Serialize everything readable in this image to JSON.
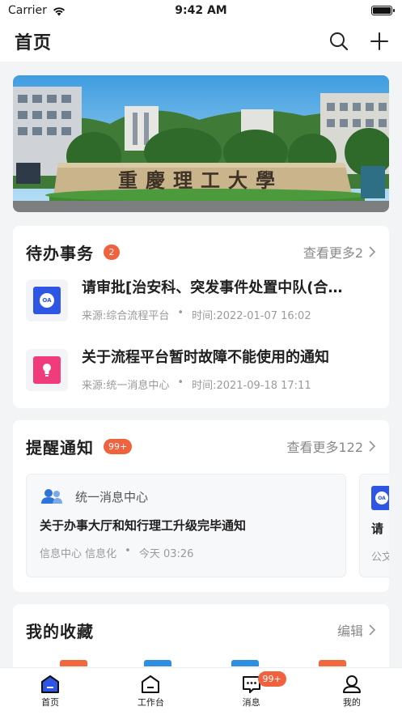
{
  "status_bar": {
    "carrier": "Carrier",
    "time": "9:42 AM"
  },
  "header": {
    "title": "首页"
  },
  "banner": {
    "gate_text": "重慶理工大學"
  },
  "todo": {
    "title": "待办事务",
    "badge": "2",
    "more": "查看更多2",
    "items": [
      {
        "icon": "OA",
        "icon_color": "#2f55e4",
        "title": "请审批[治安科、突发事件处置中队(合…",
        "source": "来源:综合流程平台",
        "time": "时间:2022-01-07 16:02"
      },
      {
        "icon": "lightbulb",
        "icon_color": "#f03c7b",
        "title": "关于流程平台暂时故障不能使用的通知",
        "source": "来源:统一消息中心",
        "time": "时间:2021-09-18 17:11"
      }
    ]
  },
  "reminders": {
    "title": "提醒通知",
    "badge": "99+",
    "more": "查看更多122",
    "items": [
      {
        "source": "统一消息中心",
        "title": "关于办事大厅和知行理工升级完毕通知",
        "tags": "信息中心 信息化",
        "time": "今天 03:26"
      },
      {
        "icon": "OA",
        "title": "请",
        "tags": "公文"
      }
    ]
  },
  "favorites": {
    "title": "我的收藏",
    "edit": "编辑",
    "peek_colors": [
      "#f06a3e",
      "#2e8fe0",
      "#2e8fe0",
      "#f06a3e"
    ]
  },
  "tabs": [
    {
      "label": "首页",
      "icon": "home-icon"
    },
    {
      "label": "工作台",
      "icon": "workbench-icon"
    },
    {
      "label": "消息",
      "icon": "message-icon",
      "badge": "99+"
    },
    {
      "label": "我的",
      "icon": "profile-icon"
    }
  ],
  "colors": {
    "accent": "#f0613e",
    "oa_blue": "#2f55e4",
    "pink": "#f03c7b"
  }
}
